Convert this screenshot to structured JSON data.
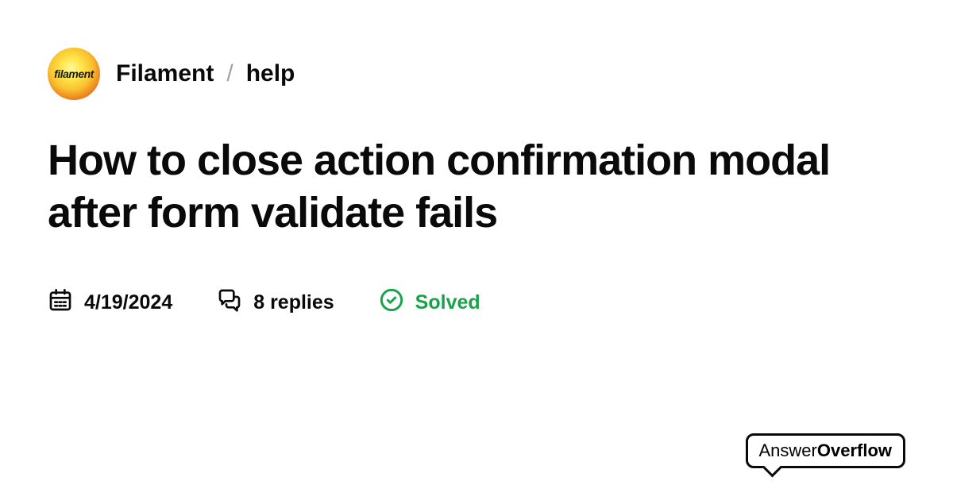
{
  "header": {
    "avatar_text": "filament",
    "community": "Filament",
    "separator": "/",
    "channel": "help"
  },
  "title": "How to close action confirmation modal after form validate fails",
  "meta": {
    "date": "4/19/2024",
    "replies": "8 replies",
    "status": "Solved"
  },
  "footer": {
    "brand_part1": "Answer",
    "brand_part2": "Overflow"
  }
}
